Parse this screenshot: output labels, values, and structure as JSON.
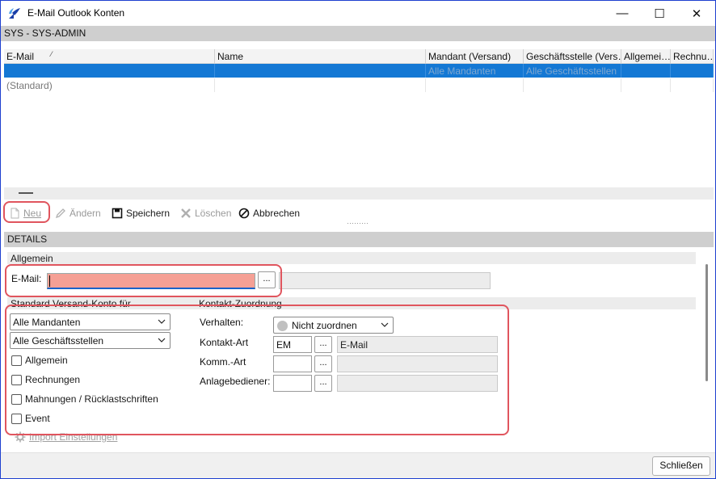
{
  "window": {
    "title": "E-Mail Outlook Konten",
    "min_glyph": "—",
    "max_glyph": "☐",
    "close_glyph": "✕"
  },
  "user_bar": "SYS - SYS-ADMIN",
  "grid": {
    "columns": [
      "E-Mail",
      "Name",
      "Mandant (Versand)",
      "Geschäftsstelle (Vers…",
      "Allgemei…",
      "Rechnu…"
    ],
    "sort_glyph": "⁄",
    "selected_row": [
      "",
      "",
      "Alle Mandanten",
      "Alle Geschäftsstellen",
      "",
      ""
    ],
    "standard_row": [
      "(Standard)",
      "",
      "",
      "",
      "",
      ""
    ]
  },
  "toolbar": {
    "new": "Neu",
    "edit": "Ändern",
    "save": "Speichern",
    "delete": "Löschen",
    "cancel": "Abbrechen",
    "grip": "·········"
  },
  "details": {
    "header": "DETAILS",
    "section_general": "Allgemein",
    "email_label": "E-Mail:",
    "email_value": "",
    "dots": "...",
    "section_versand": "Standard Versand-Konto für",
    "section_kontakt": "Kontakt-Zuordnung",
    "mandant_select": "Alle Mandanten",
    "geschaeftsstelle_select": "Alle Geschäftsstellen",
    "checkboxes": [
      "Allgemein",
      "Rechnungen",
      "Mahnungen / Rücklastschriften",
      "Event"
    ],
    "verhalten_label": "Verhalten:",
    "verhalten_value": "Nicht zuordnen",
    "kontakt_art_label": "Kontakt-Art",
    "kontakt_art_code": "EM",
    "kontakt_art_desc": "E-Mail",
    "komm_art_label": "Komm.-Art",
    "anlagebediener_label": "Anlagebediener:",
    "import_label": "Import Einstellungen"
  },
  "footer": {
    "close_button": "Schließen"
  },
  "colors": {
    "selection": "#1478d4",
    "email_required": "#f5a095",
    "highlight": "#e0555e"
  }
}
